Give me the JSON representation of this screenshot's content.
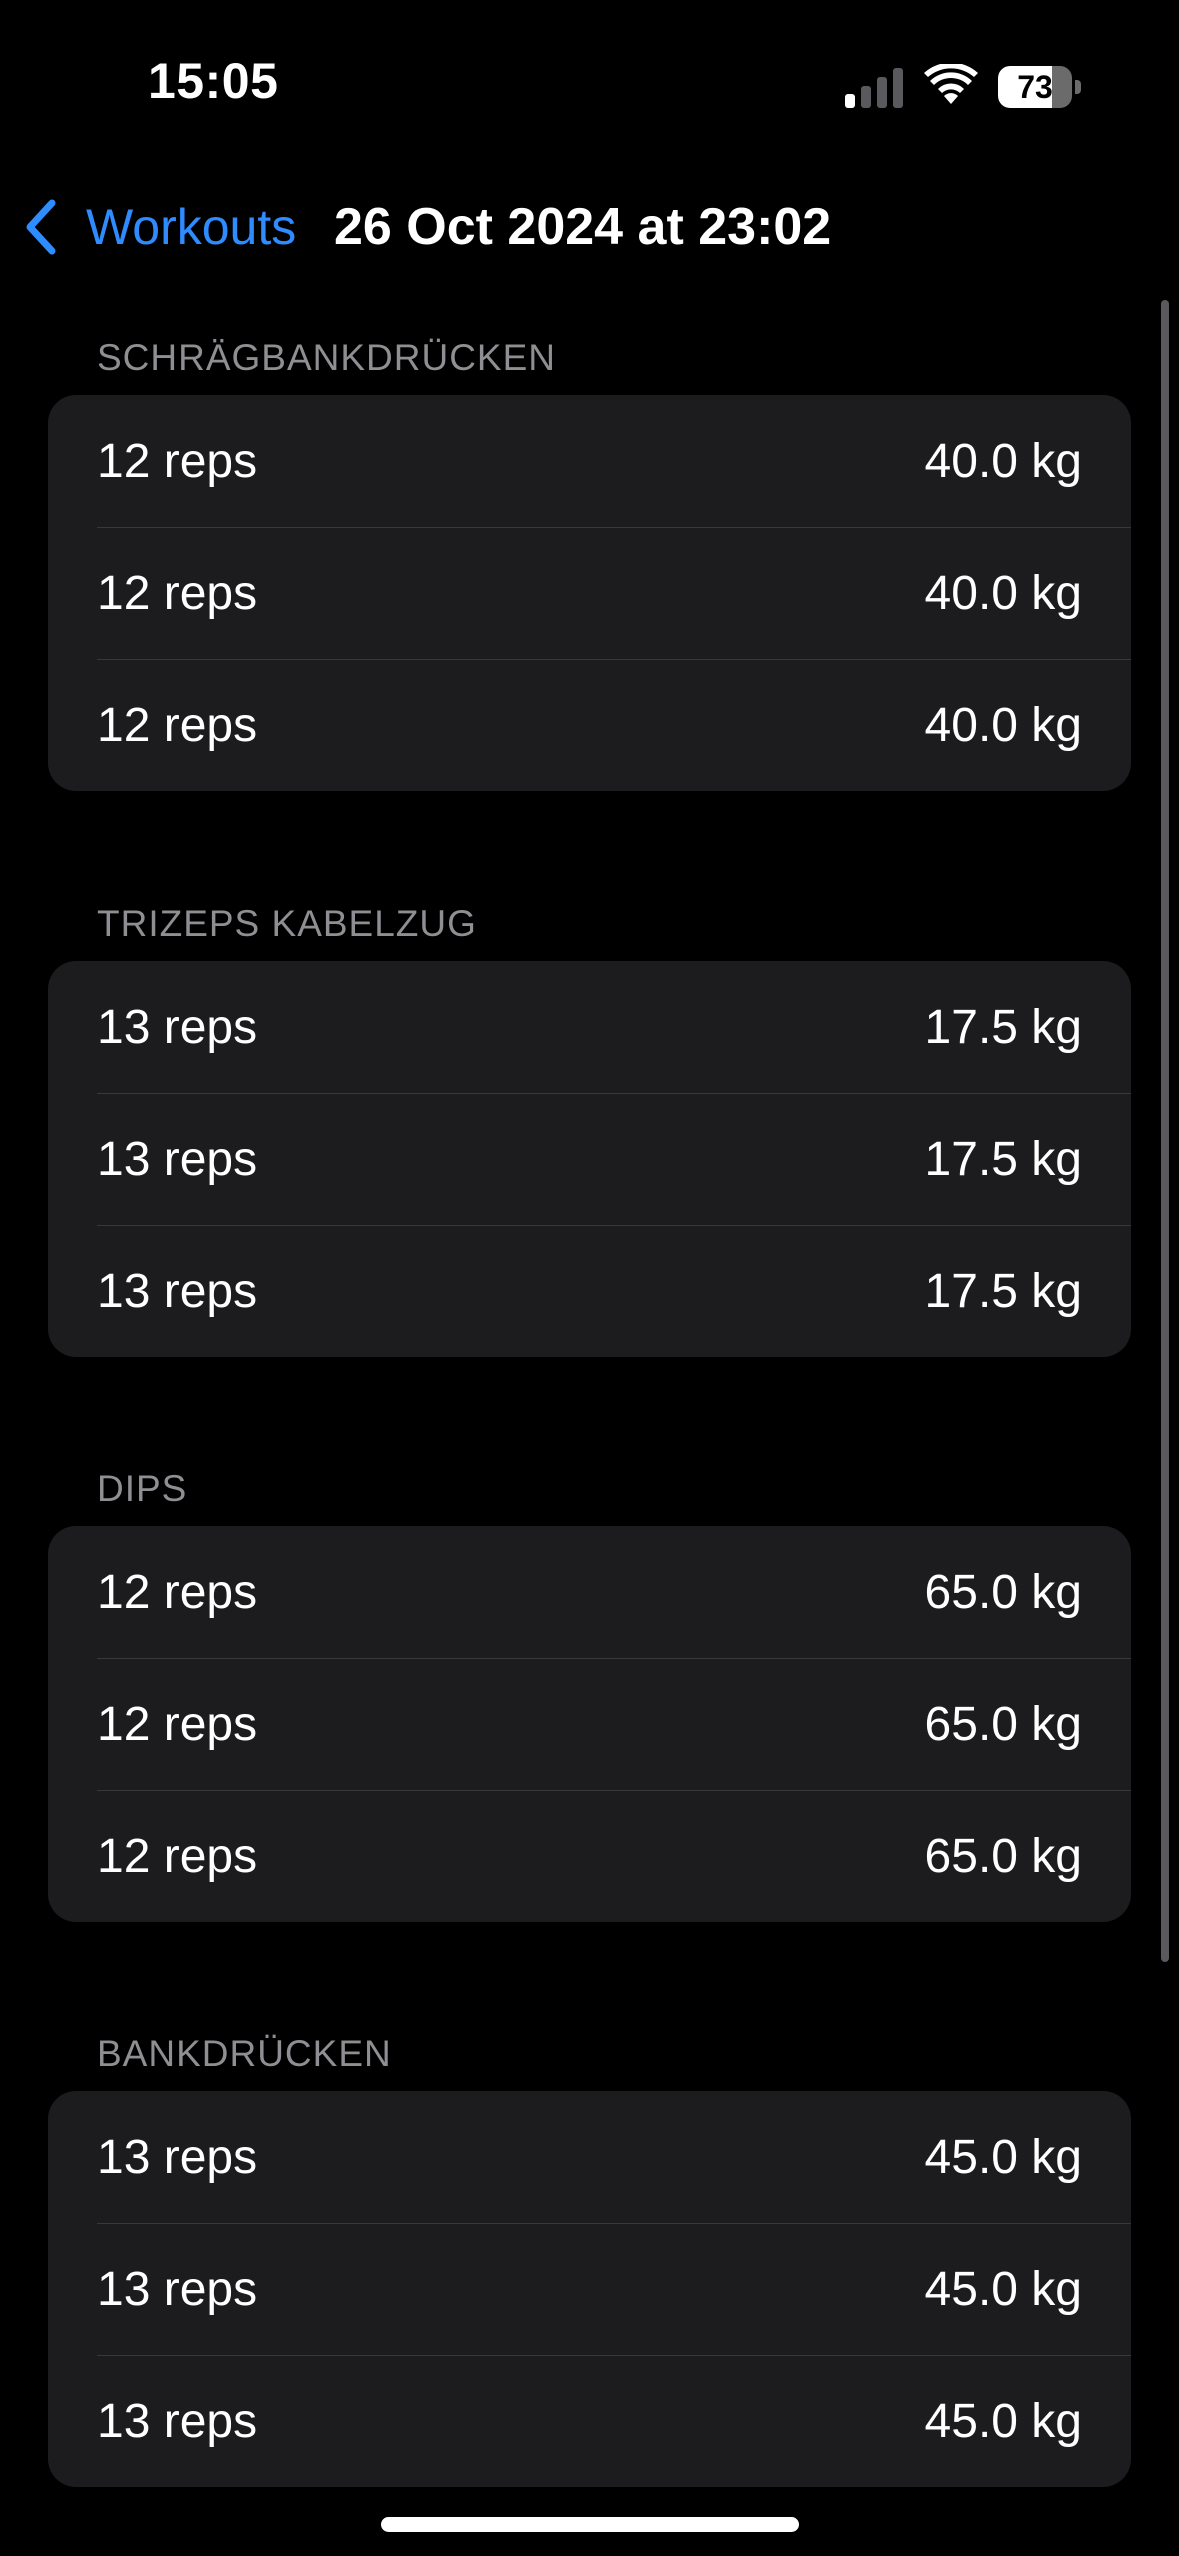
{
  "status_bar": {
    "time": "15:05",
    "signal_icon": "cellular-signal-icon",
    "wifi_icon": "wifi-icon",
    "battery_level": "73",
    "battery_percent": 73
  },
  "nav": {
    "back_label": "Workouts",
    "back_icon": "chevron-left-icon",
    "title": "26 Oct 2024 at 23:02",
    "accent_color": "#2f8cff"
  },
  "sections": [
    {
      "header": "SCHRÄGBANKDRÜCKEN",
      "sets": [
        {
          "reps": "12 reps",
          "weight": "40.0 kg"
        },
        {
          "reps": "12 reps",
          "weight": "40.0 kg"
        },
        {
          "reps": "12 reps",
          "weight": "40.0 kg"
        }
      ]
    },
    {
      "header": "TRIZEPS KABELZUG",
      "sets": [
        {
          "reps": "13 reps",
          "weight": "17.5 kg"
        },
        {
          "reps": "13 reps",
          "weight": "17.5 kg"
        },
        {
          "reps": "13 reps",
          "weight": "17.5 kg"
        }
      ]
    },
    {
      "header": "DIPS",
      "sets": [
        {
          "reps": "12 reps",
          "weight": "65.0 kg"
        },
        {
          "reps": "12 reps",
          "weight": "65.0 kg"
        },
        {
          "reps": "12 reps",
          "weight": "65.0 kg"
        }
      ]
    },
    {
      "header": "BANKDRÜCKEN",
      "sets": [
        {
          "reps": "13 reps",
          "weight": "45.0 kg"
        },
        {
          "reps": "13 reps",
          "weight": "45.0 kg"
        },
        {
          "reps": "13 reps",
          "weight": "45.0 kg"
        }
      ]
    }
  ],
  "colors": {
    "background": "#000000",
    "card": "#1c1c1e",
    "separator": "#38383a",
    "section_header": "#8e8e93"
  }
}
